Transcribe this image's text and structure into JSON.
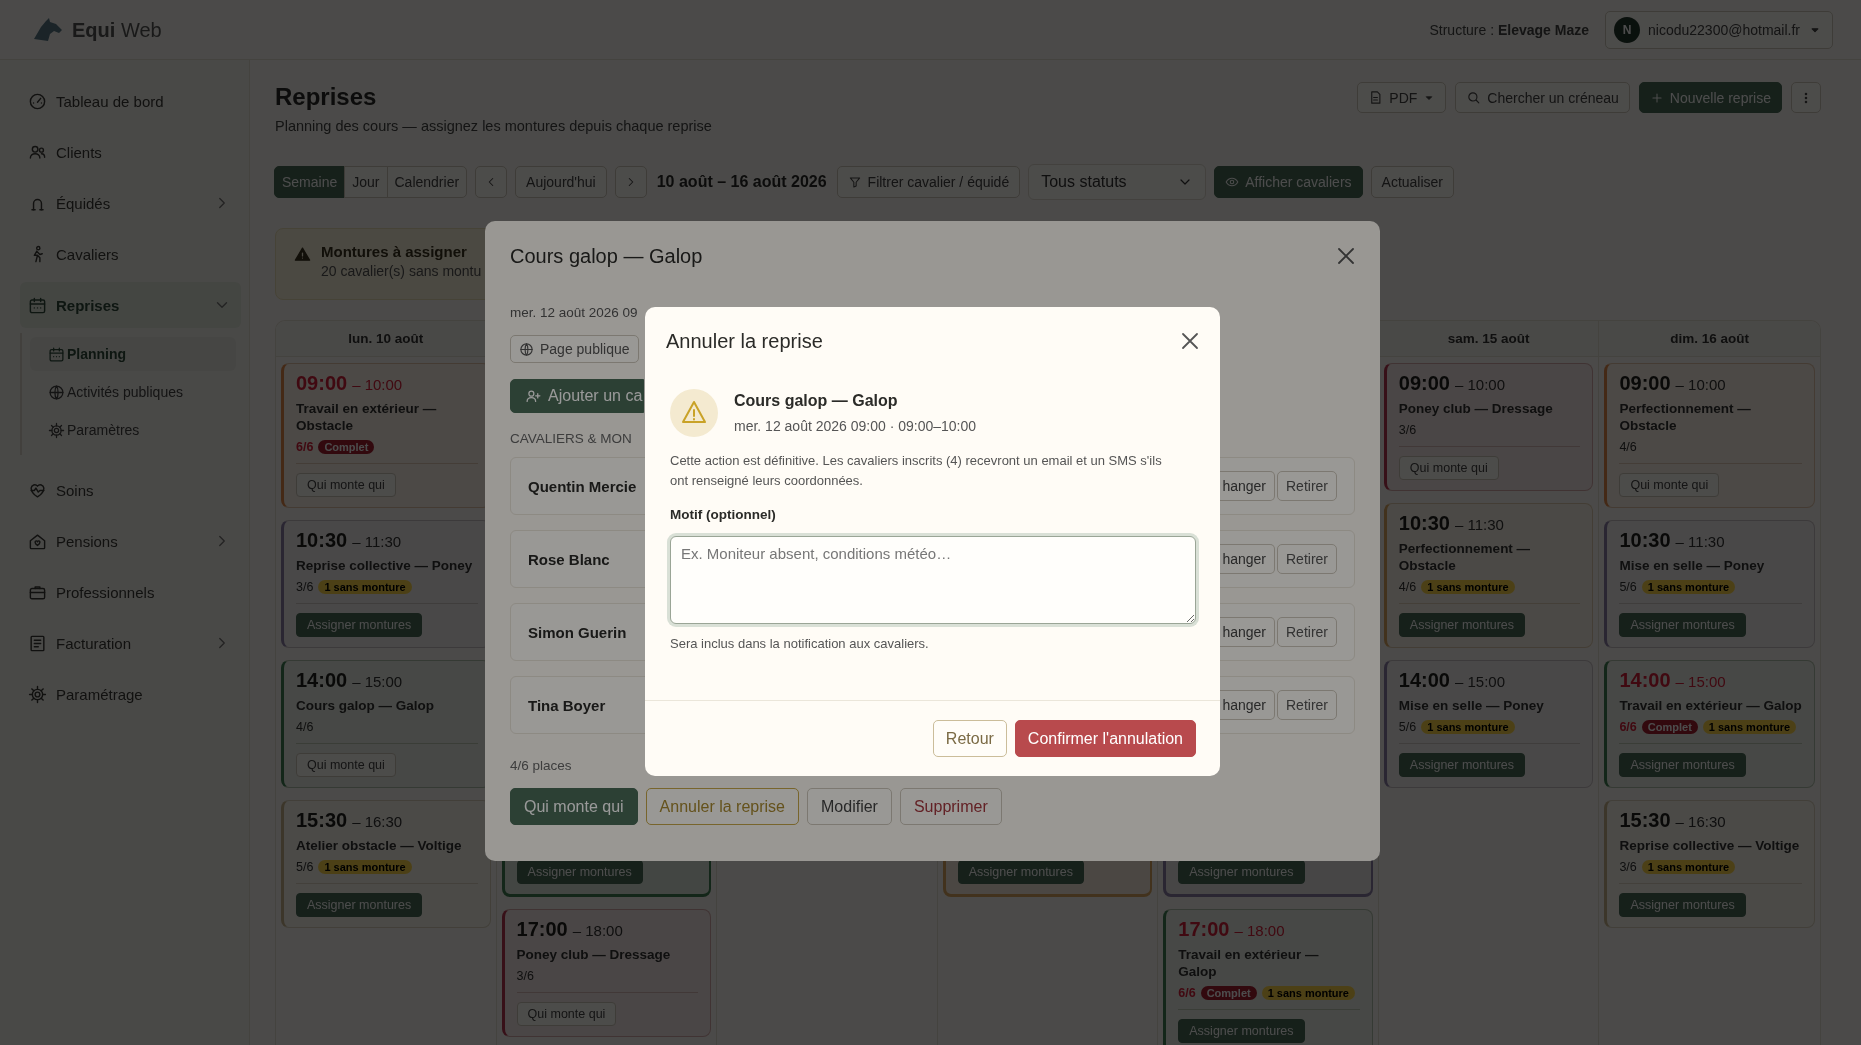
{
  "topbar": {
    "brand": "**Equi** Web",
    "structure": "Structure : **Elevage Maze**",
    "user": {
      "initial": "N",
      "email": "nicodu22300@hotmail.fr"
    }
  },
  "sidebar": {
    "items": [
      {
        "kind": "link",
        "label": "Tableau de bord",
        "selected": false
      },
      {
        "kind": "link",
        "label": "Clients",
        "selected": false
      },
      {
        "kind": "group",
        "label": "Équidés",
        "selected": false,
        "expanded": false
      },
      {
        "kind": "link",
        "label": "Cavaliers",
        "selected": false
      },
      {
        "kind": "group",
        "label": "Reprises",
        "selected": true,
        "expanded": true,
        "children": [
          {
            "label": "Planning",
            "selected": true
          },
          {
            "label": "Activités publiques",
            "selected": false
          },
          {
            "label": "Paramètres",
            "selected": false
          }
        ]
      },
      {
        "kind": "link",
        "label": "Soins",
        "selected": false
      },
      {
        "kind": "group",
        "label": "Pensions",
        "selected": false,
        "expanded": false
      },
      {
        "kind": "link",
        "label": "Professionnels",
        "selected": false
      },
      {
        "kind": "group",
        "label": "Facturation",
        "selected": false,
        "expanded": false
      },
      {
        "kind": "link",
        "label": "Paramétrage",
        "selected": false
      }
    ]
  },
  "header": {
    "title": "Reprises",
    "subtitle": "Planning des cours — assignez les montures depuis chaque reprise",
    "actions": [
      {
        "kind": "menu",
        "label": "PDF"
      },
      {
        "kind": "search",
        "label": "Chercher un créneau"
      },
      {
        "kind": "primary",
        "label": "Nouvelle reprise"
      },
      {
        "kind": "more"
      }
    ]
  },
  "toolbar": {
    "views": [
      {
        "label": "Semaine",
        "selected": true
      },
      {
        "label": "Jour",
        "selected": false
      },
      {
        "label": "Calendrier",
        "selected": false
      }
    ],
    "today": "Aujourd'hui",
    "range": "10 août – 16 août 2026",
    "filter": "Filtrer cavalier / équidé",
    "status": "Tous statuts",
    "show_riders": {
      "label": "Afficher cavaliers",
      "on": true
    },
    "refresh": "Actualiser"
  },
  "alert": {
    "title": "Montures à assigner",
    "text": "20 cavalier(s) sans montu"
  },
  "calendar": {
    "columns": [
      {
        "day": "lun. 10 août",
        "cards": [
          {
            "kind": "lesson",
            "color": "#442916",
            "start": "09:00",
            "end": "– 10:00",
            "title": "Travail en extérieur — Obstacle",
            "count": "6/6",
            "full": true,
            "badges": [
              {
                "kind": "full",
                "label": "Complet"
              }
            ],
            "action": {
              "kind": "outline",
              "label": "Qui monte qui"
            }
          },
          {
            "kind": "lesson",
            "color": "#2a2632",
            "start": "10:30",
            "end": "– 11:30",
            "title": "Reprise collective — Poney",
            "count": "3/6",
            "full": false,
            "badges": [
              {
                "kind": "missing",
                "label": "1 sans monture"
              }
            ],
            "action": {
              "kind": "primary",
              "label": "Assigner montures"
            }
          },
          {
            "kind": "lesson",
            "color": "#132619",
            "start": "14:00",
            "end": "– 15:00",
            "title": "Cours galop — Galop",
            "count": "4/6",
            "full": false,
            "action": {
              "kind": "outline",
              "label": "Qui monte qui"
            }
          },
          {
            "kind": "lesson",
            "color": "#3c362a",
            "start": "15:30",
            "end": "– 16:30",
            "title": "Atelier obstacle — Voltige",
            "count": "5/6",
            "full": false,
            "badges": [
              {
                "kind": "missing",
                "label": "1 sans monture"
              }
            ],
            "action": {
              "kind": "primary",
              "label": "Assigner montures"
            }
          }
        ]
      },
      {
        "cards": [
          {
            "kind": "tail",
            "color": "#132619",
            "action": {
              "kind": "primary",
              "label": "Assigner montures"
            }
          },
          {
            "kind": "lesson",
            "color": "#371018",
            "start": "17:00",
            "end": "– 18:00",
            "title": "Poney club — Dressage",
            "count": "3/6",
            "full": false,
            "action": {
              "kind": "outline",
              "label": "Qui monte qui"
            }
          }
        ]
      },
      {},
      {
        "cards": [
          {
            "kind": "tail",
            "color": "#42321d",
            "action": {
              "kind": "primary",
              "label": "Assigner montures"
            }
          }
        ]
      },
      {
        "cards": [
          {
            "kind": "tail",
            "color": "#2a2632",
            "action": {
              "kind": "primary",
              "label": "Assigner montures"
            }
          },
          {
            "kind": "lesson",
            "color": "#132619",
            "start": "17:00",
            "end": "– 18:00",
            "title": "Travail en extérieur — Galop",
            "count": "6/6",
            "full": true,
            "badges": [
              {
                "kind": "full",
                "label": "Complet"
              },
              {
                "kind": "missing",
                "label": "1 sans monture"
              }
            ],
            "action": {
              "kind": "primary",
              "label": "Assigner montures"
            }
          }
        ]
      },
      {
        "day": "sam. 15 août",
        "cards": [
          {
            "kind": "lesson",
            "color": "#371018",
            "start": "09:00",
            "end": "– 10:00",
            "title": "Poney club — Dressage",
            "count": "3/6",
            "full": false,
            "action": {
              "kind": "outline",
              "label": "Qui monte qui"
            }
          },
          {
            "kind": "lesson",
            "color": "#42321d",
            "start": "10:30",
            "end": "– 11:30",
            "title": "Perfectionnement — Obstacle",
            "count": "4/6",
            "full": false,
            "badges": [
              {
                "kind": "missing",
                "label": "1 sans monture"
              }
            ],
            "action": {
              "kind": "primary",
              "label": "Assigner montures"
            }
          },
          {
            "kind": "lesson",
            "color": "#2a2632",
            "start": "14:00",
            "end": "– 15:00",
            "title": "Mise en selle — Poney",
            "count": "5/6",
            "full": false,
            "badges": [
              {
                "kind": "missing",
                "label": "1 sans monture"
              }
            ],
            "action": {
              "kind": "primary",
              "label": "Assigner montures"
            }
          }
        ]
      },
      {
        "day": "dim. 16 août",
        "cards": [
          {
            "kind": "lesson",
            "color": "#442916",
            "start": "09:00",
            "end": "– 10:00",
            "title": "Perfectionnement — Obstacle",
            "count": "4/6",
            "full": false,
            "action": {
              "kind": "outline",
              "label": "Qui monte qui"
            }
          },
          {
            "kind": "lesson",
            "color": "#2a2632",
            "start": "10:30",
            "end": "– 11:30",
            "title": "Mise en selle — Poney",
            "count": "5/6",
            "full": false,
            "badges": [
              {
                "kind": "missing",
                "label": "1 sans monture"
              }
            ],
            "action": {
              "kind": "primary",
              "label": "Assigner montures"
            }
          },
          {
            "kind": "lesson",
            "color": "#132619",
            "start": "14:00",
            "end": "– 15:00",
            "title": "Travail en extérieur — Galop",
            "count": "6/6",
            "full": true,
            "badges": [
              {
                "kind": "full",
                "label": "Complet"
              },
              {
                "kind": "missing",
                "label": "1 sans monture"
              }
            ],
            "action": {
              "kind": "primary",
              "label": "Assigner montures"
            }
          },
          {
            "kind": "lesson",
            "color": "#3c362a",
            "start": "15:30",
            "end": "– 16:30",
            "title": "Reprise collective — Voltige",
            "count": "3/6",
            "full": false,
            "badges": [
              {
                "kind": "missing",
                "label": "1 sans monture"
              }
            ],
            "action": {
              "kind": "primary",
              "label": "Assigner montures"
            }
          }
        ]
      }
    ]
  },
  "course_modal": {
    "title": "Cours galop — Galop",
    "date": "mer. 12 août 2026 09",
    "public_page": "Page publique",
    "add_rider": "Ajouter un ca",
    "section": "CAVALIERS & MON",
    "riders": [
      {
        "name": "Quentin Mercie",
        "change": "hanger",
        "remove": "Retirer"
      },
      {
        "name": "Rose Blanc",
        "change": "hanger",
        "remove": "Retirer"
      },
      {
        "name": "Simon Guerin",
        "change": "hanger",
        "remove": "Retirer"
      },
      {
        "name": "Tina Boyer",
        "change": "hanger",
        "remove": "Retirer"
      }
    ],
    "places": "4/6 places",
    "buttons": [
      {
        "kind": "primary",
        "label": "Qui monte qui"
      },
      {
        "kind": "warning",
        "label": "Annuler la reprise"
      },
      {
        "kind": "outline",
        "label": "Modifier"
      },
      {
        "kind": "danger",
        "label": "Supprimer"
      }
    ]
  },
  "cancel_dialog": {
    "title": "Annuler la reprise",
    "lesson": "Cours galop — Galop",
    "when": "mer. 12 août 2026 09:00 · 09:00–10:00",
    "warning": "Cette action est définitive. Les cavaliers inscrits (4) recevront un email et un SMS s'ils ont renseigné leurs coordonnées.",
    "reason": {
      "label": "Motif (optionnel)",
      "placeholder": "Ex. Moniteur absent, conditions météo…",
      "hint": "Sera inclus dans la notification aux cavaliers."
    },
    "buttons": [
      {
        "kind": "outline",
        "label": "Retour"
      },
      {
        "kind": "danger",
        "label": "Confirmer l'annulation"
      }
    ]
  }
}
